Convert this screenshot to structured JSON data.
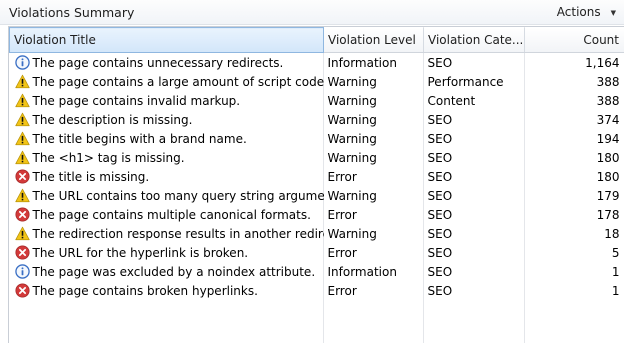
{
  "panel": {
    "title": "Violations Summary",
    "actions_label": "Actions"
  },
  "columns": {
    "title": "Violation Title",
    "level": "Violation Level",
    "category": "Violation Cate...",
    "count": "Count"
  },
  "rows": [
    {
      "icon": "info-icon",
      "title": "The page contains unnecessary redirects.",
      "level": "Information",
      "category": "SEO",
      "count": "1,164"
    },
    {
      "icon": "warning-icon",
      "title": "The page contains a large amount of script code.",
      "level": "Warning",
      "category": "Performance",
      "count": "388"
    },
    {
      "icon": "warning-icon",
      "title": "The page contains invalid markup.",
      "level": "Warning",
      "category": "Content",
      "count": "388"
    },
    {
      "icon": "warning-icon",
      "title": "The description is missing.",
      "level": "Warning",
      "category": "SEO",
      "count": "374"
    },
    {
      "icon": "warning-icon",
      "title": "The title begins with a brand name.",
      "level": "Warning",
      "category": "SEO",
      "count": "194"
    },
    {
      "icon": "warning-icon",
      "title": "The <h1> tag is missing.",
      "level": "Warning",
      "category": "SEO",
      "count": "180"
    },
    {
      "icon": "error-icon",
      "title": "The title is missing.",
      "level": "Error",
      "category": "SEO",
      "count": "180"
    },
    {
      "icon": "warning-icon",
      "title": "The URL contains too many query string arguments.",
      "level": "Warning",
      "category": "SEO",
      "count": "179"
    },
    {
      "icon": "error-icon",
      "title": "The page contains multiple canonical formats.",
      "level": "Error",
      "category": "SEO",
      "count": "178"
    },
    {
      "icon": "warning-icon",
      "title": "The redirection response results in another redirection.",
      "level": "Warning",
      "category": "SEO",
      "count": "18"
    },
    {
      "icon": "error-icon",
      "title": "The URL for the hyperlink is broken.",
      "level": "Error",
      "category": "SEO",
      "count": "5"
    },
    {
      "icon": "info-icon",
      "title": "The page was excluded by a noindex attribute.",
      "level": "Information",
      "category": "SEO",
      "count": "1"
    },
    {
      "icon": "error-icon",
      "title": "The page contains broken hyperlinks.",
      "level": "Error",
      "category": "SEO",
      "count": "1"
    }
  ],
  "colors": {
    "info": "#3a6fc4",
    "warning": "#f2c417",
    "error": "#d23a3a",
    "header_selected": "#d2e6fa"
  }
}
